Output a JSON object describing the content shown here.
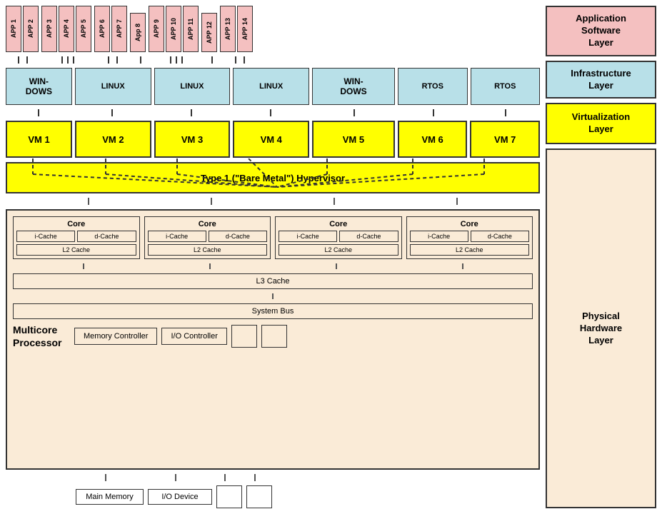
{
  "layers": {
    "app_software": {
      "label": "Application\nSoftware\nLayer",
      "apps": [
        {
          "id": "app1",
          "label": "APP 1"
        },
        {
          "id": "app2",
          "label": "APP 2"
        },
        {
          "id": "app3",
          "label": "APP 3"
        },
        {
          "id": "app4",
          "label": "APP 4"
        },
        {
          "id": "app5",
          "label": "APP 5"
        },
        {
          "id": "app6",
          "label": "APP 6"
        },
        {
          "id": "app7",
          "label": "APP 7"
        },
        {
          "id": "app8",
          "label": "App 8"
        },
        {
          "id": "app9",
          "label": "APP 9"
        },
        {
          "id": "app10",
          "label": "APP 10"
        },
        {
          "id": "app11",
          "label": "APP 11"
        },
        {
          "id": "app12",
          "label": "APP 12"
        },
        {
          "id": "app13",
          "label": "APP 13"
        },
        {
          "id": "app14",
          "label": "APP 14"
        }
      ]
    },
    "infrastructure": {
      "label": "Infrastructure\nLayer",
      "os_boxes": [
        {
          "id": "windows1",
          "label": "WIN-\nDOWS"
        },
        {
          "id": "linux1",
          "label": "LINUX"
        },
        {
          "id": "linux2",
          "label": "LINUX"
        },
        {
          "id": "linux3",
          "label": "LINUX"
        },
        {
          "id": "windows2",
          "label": "WIN-\nDOWS"
        },
        {
          "id": "rtos1",
          "label": "RTOS"
        },
        {
          "id": "rtos2",
          "label": "RTOS"
        }
      ]
    },
    "virtualization": {
      "label": "Virtualization\nLayer",
      "vms": [
        {
          "id": "vm1",
          "label": "VM 1"
        },
        {
          "id": "vm2",
          "label": "VM 2"
        },
        {
          "id": "vm3",
          "label": "VM 3"
        },
        {
          "id": "vm4",
          "label": "VM 4"
        },
        {
          "id": "vm5",
          "label": "VM 5"
        },
        {
          "id": "vm6",
          "label": "VM 6"
        },
        {
          "id": "vm7",
          "label": "VM 7"
        }
      ],
      "hypervisor_label": "Type 1 (\"Bare Metal\") Hypervisor"
    },
    "physical_hardware": {
      "label": "Physical\nHardware\nLayer",
      "cores": [
        {
          "label": "Core",
          "icache": "i-Cache",
          "dcache": "d-Cache",
          "l2": "L2 Cache"
        },
        {
          "label": "Core",
          "icache": "i-Cache",
          "dcache": "d-Cache",
          "l2": "L2 Cache"
        },
        {
          "label": "Core",
          "icache": "i-Cache",
          "dcache": "d-Cache",
          "l2": "L2 Cache"
        },
        {
          "label": "Core",
          "icache": "i-Cache",
          "dcache": "d-Cache",
          "l2": "L2 Cache"
        }
      ],
      "l3_cache": "L3 Cache",
      "system_bus": "System Bus",
      "processor_label": "Multicore\nProcessor",
      "memory_controller": "Memory Controller",
      "io_controller": "I/O Controller",
      "main_memory": "Main Memory",
      "io_device": "I/O Device"
    }
  }
}
